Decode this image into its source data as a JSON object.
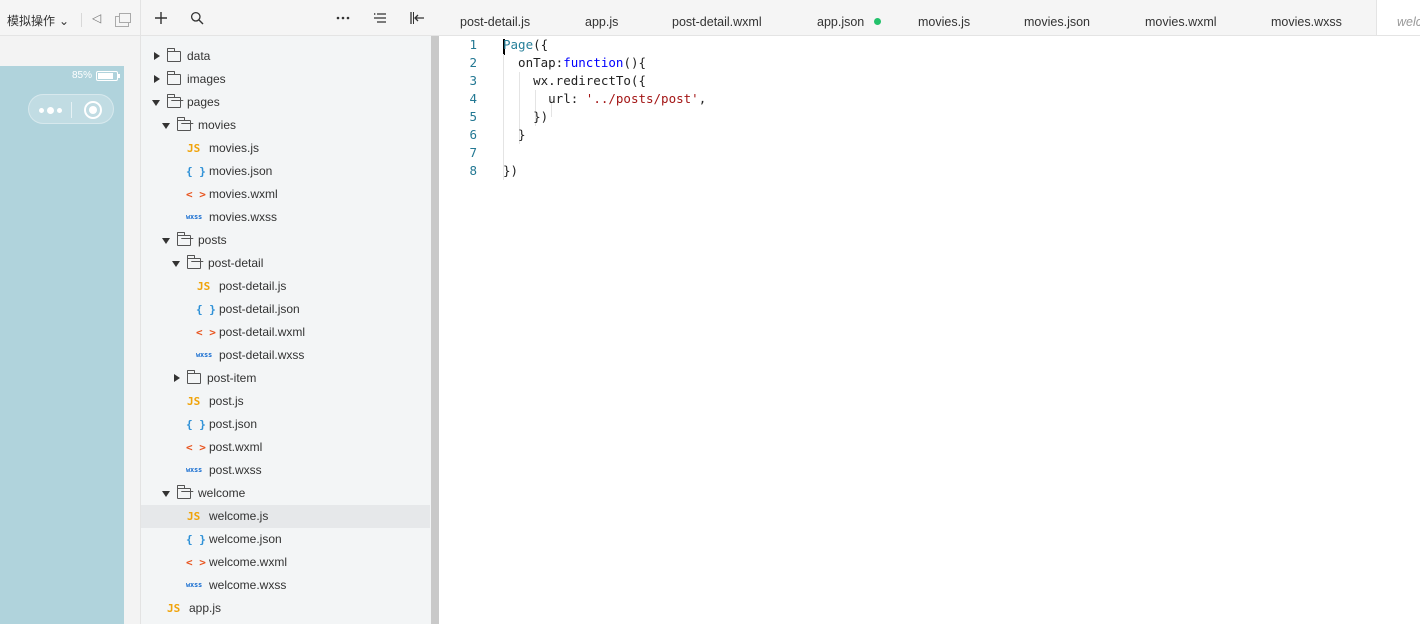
{
  "simulator": {
    "mode_label": "模拟操作",
    "battery_text": "85%",
    "battery_level": 0.85,
    "background_color": "#b0d3dc"
  },
  "explorer": {
    "toolbar_icons": [
      "plus-icon",
      "search-icon",
      "more-icon",
      "outline-icon",
      "collapse-panel-icon"
    ],
    "items": [
      {
        "label": "data",
        "kind": "folder",
        "expanded": false
      },
      {
        "label": "images",
        "kind": "folder",
        "expanded": false
      },
      {
        "label": "pages",
        "kind": "folder",
        "expanded": true
      },
      {
        "label": "movies",
        "kind": "folder",
        "expanded": true
      },
      {
        "label": "movies.js",
        "kind": "js"
      },
      {
        "label": "movies.json",
        "kind": "json"
      },
      {
        "label": "movies.wxml",
        "kind": "wxml"
      },
      {
        "label": "movies.wxss",
        "kind": "wxss"
      },
      {
        "label": "posts",
        "kind": "folder",
        "expanded": true
      },
      {
        "label": "post-detail",
        "kind": "folder",
        "expanded": true
      },
      {
        "label": "post-detail.js",
        "kind": "js"
      },
      {
        "label": "post-detail.json",
        "kind": "json"
      },
      {
        "label": "post-detail.wxml",
        "kind": "wxml"
      },
      {
        "label": "post-detail.wxss",
        "kind": "wxss"
      },
      {
        "label": "post-item",
        "kind": "folder",
        "expanded": false
      },
      {
        "label": "post.js",
        "kind": "js"
      },
      {
        "label": "post.json",
        "kind": "json"
      },
      {
        "label": "post.wxml",
        "kind": "wxml"
      },
      {
        "label": "post.wxss",
        "kind": "wxss"
      },
      {
        "label": "welcome",
        "kind": "folder",
        "expanded": true
      },
      {
        "label": "welcome.js",
        "kind": "js",
        "selected": true
      },
      {
        "label": "welcome.json",
        "kind": "json"
      },
      {
        "label": "welcome.wxml",
        "kind": "wxml"
      },
      {
        "label": "welcome.wxss",
        "kind": "wxss"
      },
      {
        "label": "app.js",
        "kind": "js"
      }
    ],
    "file_badges": {
      "js": "JS",
      "json": "{ }",
      "wxml": "< >",
      "wxss": "wxss"
    }
  },
  "tabs": [
    {
      "label": "post-detail.js"
    },
    {
      "label": "app.js"
    },
    {
      "label": "post-detail.wxml"
    },
    {
      "label": "app.json",
      "modified": true
    },
    {
      "label": "movies.js"
    },
    {
      "label": "movies.json"
    },
    {
      "label": "movies.wxml"
    },
    {
      "label": "movies.wxss"
    },
    {
      "label": "welc",
      "active": true
    }
  ],
  "editor": {
    "line_numbers": [
      "1",
      "2",
      "3",
      "4",
      "5",
      "6",
      "7",
      "8"
    ],
    "lines": [
      [
        {
          "t": "Page",
          "c": "fn"
        },
        {
          "t": "({",
          "c": "pl"
        }
      ],
      [
        {
          "t": "  onTap:",
          "c": "pl"
        },
        {
          "t": "function",
          "c": "kw"
        },
        {
          "t": "(){",
          "c": "pl"
        }
      ],
      [
        {
          "t": "    wx.redirectTo({",
          "c": "pl"
        }
      ],
      [
        {
          "t": "      url: ",
          "c": "pl"
        },
        {
          "t": "'../posts/post'",
          "c": "str"
        },
        {
          "t": ",",
          "c": "pl"
        }
      ],
      [
        {
          "t": "    })",
          "c": "pl"
        }
      ],
      [
        {
          "t": "  }",
          "c": "pl"
        }
      ],
      [],
      [
        {
          "t": "})",
          "c": "pl"
        }
      ]
    ]
  },
  "colors": {
    "accent_modified_dot": "#23c16b",
    "js_icon": "#f0a30a",
    "json_icon": "#2b8fd6",
    "wxml_icon": "#e8541e",
    "wxss_icon": "#1a6fd1"
  }
}
